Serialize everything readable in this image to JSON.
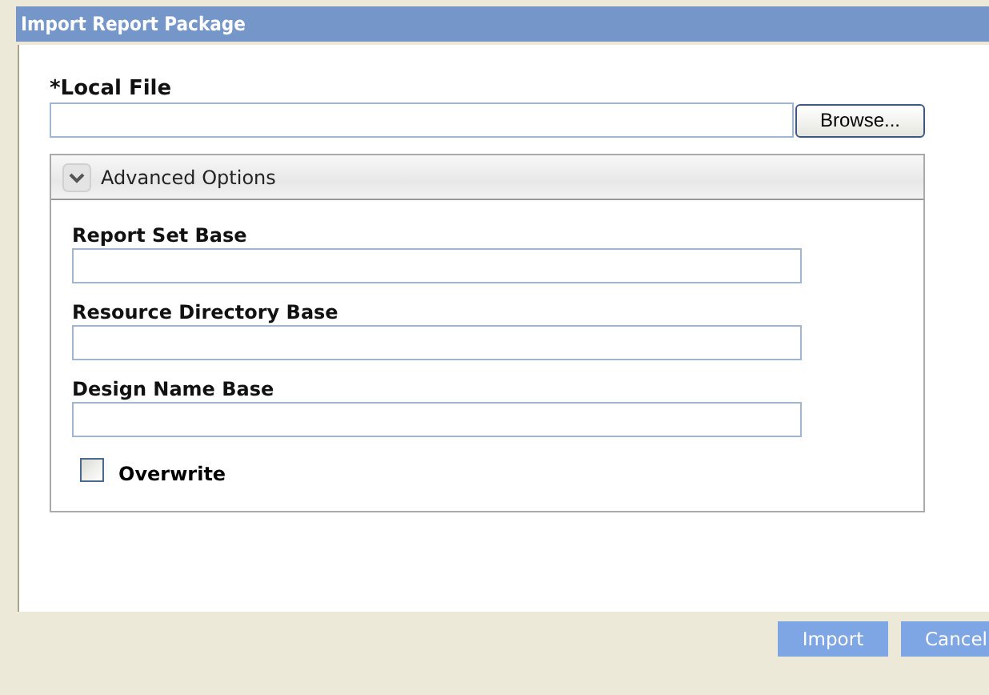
{
  "window": {
    "title": "Import Report Package"
  },
  "local_file": {
    "label": "*Local File",
    "browse_button": "Browse..."
  },
  "advanced_options": {
    "title": "Advanced Options",
    "expanded": true,
    "fields": [
      {
        "label": "Report Set Base"
      },
      {
        "label": "Resource Directory Base"
      },
      {
        "label": "Design Name Base"
      }
    ],
    "overwrite": {
      "label": "Overwrite",
      "checked": false
    }
  },
  "buttons": [
    "Import",
    "Cancel"
  ]
}
